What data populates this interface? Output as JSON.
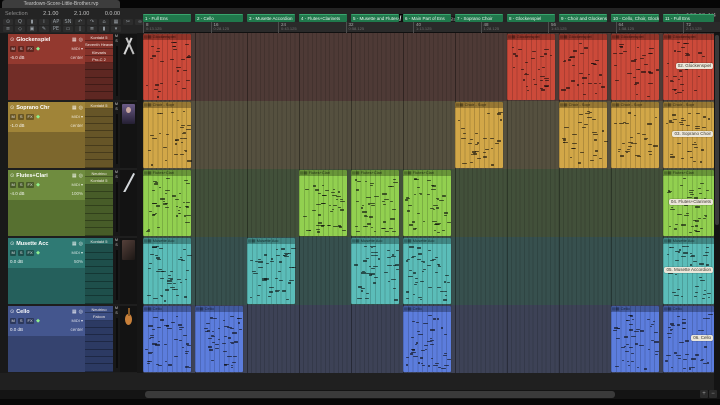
{
  "window": {
    "title": "Teardown-Score-Little-Brother.rvp"
  },
  "selection": {
    "label": "Selection",
    "start": "2.1.00",
    "end": "2.1.00",
    "length": "0.0.00"
  },
  "transport": {
    "time": "2.1.00 / 0:00.000",
    "status": "[Stopped]",
    "tempo": "♩ = 128.00",
    "time_sig": "4/4",
    "buttons": [
      {
        "name": "skip-back-button",
        "glyph": "«"
      },
      {
        "name": "skip-forward-button",
        "glyph": "»"
      },
      {
        "name": "record-button",
        "glyph": "●"
      },
      {
        "name": "play-button",
        "glyph": "▶"
      },
      {
        "name": "loop-button",
        "glyph": "∞"
      }
    ]
  },
  "toolbar": {
    "icons_row1": [
      {
        "name": "record-options-icon",
        "glyph": "⊙"
      },
      {
        "name": "zoom-icon",
        "glyph": "Q"
      },
      {
        "name": "level-meter-icon",
        "glyph": "▮"
      },
      {
        "name": "info-icon",
        "glyph": "i"
      },
      {
        "name": "auto-punch-icon",
        "glyph": "AP"
      },
      {
        "name": "snap-icon",
        "glyph": "SN"
      },
      {
        "name": "undo-icon",
        "glyph": "↶"
      },
      {
        "name": "redo-icon",
        "glyph": "↷"
      },
      {
        "name": "home-icon",
        "glyph": "⌂"
      },
      {
        "name": "mixer-grid-icon",
        "glyph": "▦"
      },
      {
        "name": "scissors-icon",
        "glyph": "✂"
      },
      {
        "name": "loop-infinity-icon",
        "glyph": "∞"
      },
      {
        "name": "step-grid-icon",
        "glyph": "▤"
      },
      {
        "name": "home-view-icon",
        "glyph": "⌂"
      }
    ],
    "icons_row2": [
      {
        "name": "eq-lines-icon",
        "glyph": "≡"
      },
      {
        "name": "draw-icon",
        "glyph": "◇"
      },
      {
        "name": "lock-icon",
        "glyph": "▣"
      },
      {
        "name": "pencil-icon",
        "glyph": "✎"
      },
      {
        "name": "pre-encode-icon",
        "glyph": "PE"
      },
      {
        "name": "track-min-icon",
        "glyph": "▭"
      },
      {
        "name": "track-small-icon",
        "glyph": "▯"
      },
      {
        "name": "track-stack-icon",
        "glyph": "≣"
      },
      {
        "name": "track-big-icon",
        "glyph": "▮"
      },
      {
        "name": "tracks-menu-icon",
        "glyph": "▾"
      }
    ]
  },
  "markers": [
    "1 - Full Ens",
    "2 - Cello",
    "3 - Musette Accordion",
    "4 - Flutes+Clarinets",
    "5 - Musette and Flutes+Clarinets",
    "6 - Main Part of Ens",
    "7 - Soprano Choir",
    "8 - Glockenspiel",
    "9 - Choir and Glockenspiel",
    "10 - Cello, Choir, Glockenspiel",
    "11 - Full Ens"
  ],
  "ruler": {
    "ticks": [
      {
        "bar": "8",
        "time": "0:13.125"
      },
      {
        "bar": "16",
        "time": "0:28.125"
      },
      {
        "bar": "24",
        "time": "0:43.125"
      },
      {
        "bar": "32",
        "time": "0:58.125"
      },
      {
        "bar": "40",
        "time": "1:13.125"
      },
      {
        "bar": "48",
        "time": "1:28.125"
      },
      {
        "bar": "56",
        "time": "1:43.125"
      },
      {
        "bar": "64",
        "time": "1:58.125"
      },
      {
        "bar": "72",
        "time": "2:13.125"
      }
    ]
  },
  "tracks": [
    {
      "name": "Glockenspiel",
      "mute": "M",
      "solo": "S",
      "midi": "MIDI ▾",
      "volume": "-6.0 dB",
      "pan": "center",
      "plugins": [
        "Kontakt 5",
        "Seventh Heaven Pr",
        "Klevaris",
        "Pro-C 2"
      ],
      "clip_name": "Glockenspiel",
      "final_label": "02. Glockenspiel",
      "image": "mallets",
      "colors": {
        "base": "#93392f",
        "lower": "#722d27",
        "region": "#cc4a3a",
        "row": "#4e3a36",
        "strip": "#5e2722",
        "slot": "#84322a"
      },
      "sections": [
        0,
        7,
        8,
        9,
        10
      ]
    },
    {
      "name": "Soprano Chr",
      "mute": "M",
      "solo": "S",
      "midi": "MIDI ▾",
      "volume": "-1.0 dB",
      "pan": "center",
      "plugins": [
        "Kontakt 5"
      ],
      "clip_name": "Choir - Sopr",
      "final_label": "03. Soprano Choir",
      "image": "singer",
      "colors": {
        "base": "#a08438",
        "lower": "#7d672d",
        "region": "#d2a748",
        "row": "#55503f",
        "strip": "#665527",
        "slot": "#8f7531"
      },
      "sections": [
        0,
        6,
        8,
        9,
        10
      ]
    },
    {
      "name": "Flutes+Clari",
      "mute": "M",
      "solo": "S",
      "midi": "MIDI ▾",
      "volume": "-4.0 dB",
      "pan": "100%",
      "plugins": [
        "Neutrino",
        "Kontakt 5"
      ],
      "clip_name": "Flutes+Clari",
      "final_label": "04. Flutes+Clarinets",
      "image": "clarinet",
      "colors": {
        "base": "#6f8c3f",
        "lower": "#577030",
        "region": "#92d050",
        "row": "#42503a",
        "strip": "#475c28",
        "slot": "#627d35"
      },
      "sections": [
        0,
        3,
        4,
        5,
        10
      ]
    },
    {
      "name": "Musette Acc",
      "mute": "M",
      "solo": "S",
      "midi": "MIDI ▾",
      "volume": "0.0 dB",
      "pan": "50%",
      "plugins": [
        "Kontakt 5"
      ],
      "clip_name": "Musette Acc",
      "final_label": "05. Musette Accordion",
      "image": "photo",
      "colors": {
        "base": "#2f7a74",
        "lower": "#25605c",
        "region": "#5bbdb9",
        "row": "#37504e",
        "strip": "#1e4f4b",
        "slot": "#2a6d68"
      },
      "sections": [
        0,
        2,
        4,
        5,
        10
      ]
    },
    {
      "name": "Cello",
      "mute": "M",
      "solo": "S",
      "midi": "MIDI ▾",
      "volume": "0.0 dB",
      "pan": "center",
      "plugins": [
        "Neutrino",
        "Falcon"
      ],
      "clip_name": "Cello",
      "final_label": "06. Cello",
      "image": "cello",
      "colors": {
        "base": "#44568e",
        "lower": "#35436f",
        "region": "#5c7ddd",
        "row": "#3d4256",
        "strip": "#2c3a63",
        "slot": "#3c4e83"
      },
      "sections": [
        0,
        1,
        5,
        9,
        10
      ]
    }
  ]
}
